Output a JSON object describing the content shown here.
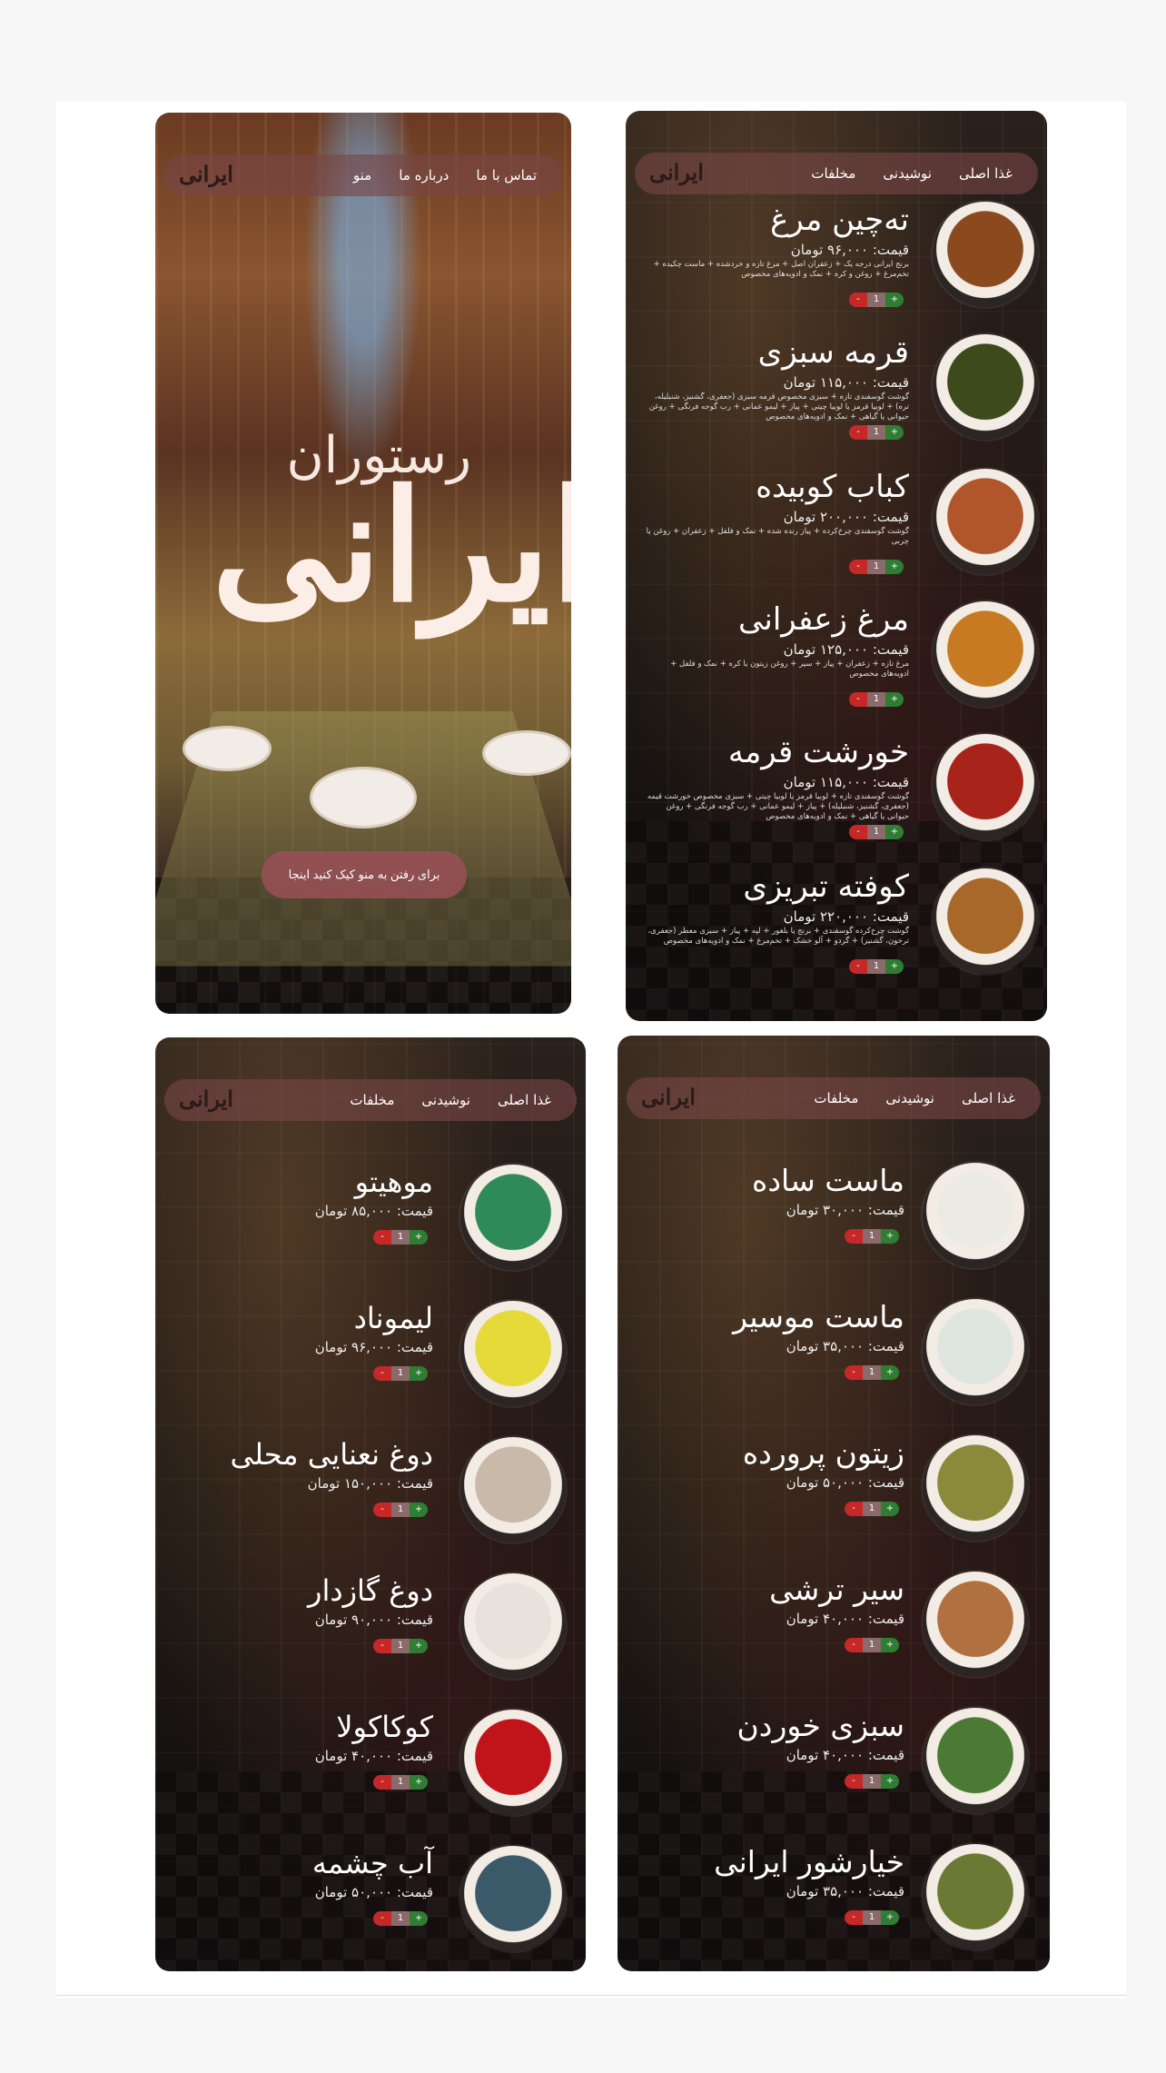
{
  "hero": {
    "logo": "ایرانی",
    "nav": [
      "تماس با ما",
      "درباره ما",
      "منو"
    ],
    "title_small": "رستوران",
    "title_big": "ایرانی",
    "cta": "برای رفتن به منو کیک کنید اینجا"
  },
  "menu_nav": [
    "غذا اصلی",
    "نوشیدنی",
    "مخلفات"
  ],
  "stepper": {
    "minus": "-",
    "qty": "1",
    "plus": "+"
  },
  "main_dishes": [
    {
      "name": "ته‌چین مرغ",
      "price": "قیمت: ۹۶,۰۰۰ تومان",
      "desc": "برنج ایرانی درجه یک + زعفران اصل + مرغ تازه و خردشده + ماست چکیده + تخم‌مرغ + روغن و کره + نمک و ادویه‌های مخصوص",
      "color": "#8a4a1e"
    },
    {
      "name": "قرمه سبزی",
      "price": "قیمت: ۱۱۵,۰۰۰ تومان",
      "desc": "گوشت گوسفندی تازه + سبزی مخصوص قرمه سبزی (جعفری، گشنیز، شنبلیله، تره) + لوبیا قرمز یا لوبیا چیتی + پیاز + لیمو عمانی + رب گوجه فرنگی + روغن حیوانی یا گیاهی + نمک و ادویه‌های مخصوص",
      "color": "#3d4a1c"
    },
    {
      "name": "کباب کوبیده",
      "price": "قیمت: ۲۰۰,۰۰۰ تومان",
      "desc": "گوشت گوسفندی چرخ‌کرده + پیاز رنده شده + نمک و فلفل + زعفران + روغن یا چربی",
      "color": "#b0562a"
    },
    {
      "name": "مرغ زعفرانی",
      "price": "قیمت: ۱۲۵,۰۰۰ تومان",
      "desc": "مرغ تازه + زعفران + پیاز + سیر + روغن زیتون یا کره + نمک و فلفل + ادویه‌های مخصوص",
      "color": "#c77a22"
    },
    {
      "name": "خورشت قرمه",
      "price": "قیمت: ۱۱۵,۰۰۰ تومان",
      "desc": "گوشت گوسفندی تازه + لوبیا قرمز یا لوبیا چیتی + سبزی مخصوص خورشت قیمه (جعفری، گشنیز، شنبلیله) + پیاز + لیمو عمانی + رب گوجه فرنگی + روغن حیوانی یا گیاهی + نمک و ادویه‌های مخصوص",
      "color": "#a8241a"
    },
    {
      "name": "کوفته تبریزی",
      "price": "قیمت: ۲۲۰,۰۰۰ تومان",
      "desc": "گوشت چرخ‌کرده گوسفندی + برنج یا بلغور + لپه + پیاز + سبزی معطر (جعفری، ترخون، گشنیز) + گردو + آلو خشک + تخم‌مرغ + نمک و ادویه‌های مخصوص",
      "color": "#a8682a"
    }
  ],
  "drinks": [
    {
      "name": "موهیتو",
      "price": "قیمت: ۸۵,۰۰۰ تومان",
      "color": "#2f8a5a"
    },
    {
      "name": "لیموناد",
      "price": "قیمت: ۹۶,۰۰۰ تومان",
      "color": "#e6d93a"
    },
    {
      "name": "دوغ نعنایی محلی",
      "price": "قیمت: ۱۵۰,۰۰۰ تومان",
      "color": "#c9b9a8"
    },
    {
      "name": "دوغ گازدار",
      "price": "قیمت: ۹۰,۰۰۰ تومان",
      "color": "#e9e2dc"
    },
    {
      "name": "کوکاکولا",
      "price": "قیمت: ۴۰,۰۰۰ تومان",
      "color": "#c0141a"
    },
    {
      "name": "آب چشمه",
      "price": "قیمت: ۵۰,۰۰۰ تومان",
      "color": "#3a5a6a"
    }
  ],
  "sides": [
    {
      "name": "ماست ساده",
      "price": "قیمت: ۳۰,۰۰۰ تومان",
      "color": "#eceae4"
    },
    {
      "name": "ماست موسیر",
      "price": "قیمت: ۳۵,۰۰۰ تومان",
      "color": "#dfe6e0"
    },
    {
      "name": "زیتون پرورده",
      "price": "قیمت: ۵۰,۰۰۰ تومان",
      "color": "#8a8a3a"
    },
    {
      "name": "سیر ترشی",
      "price": "قیمت: ۴۰,۰۰۰ تومان",
      "color": "#b07040"
    },
    {
      "name": "سبزی خوردن",
      "price": "قیمت: ۴۰,۰۰۰ تومان",
      "color": "#4a7a34"
    },
    {
      "name": "خیارشور ایرانی",
      "price": "قیمت: ۳۵,۰۰۰ تومان",
      "color": "#6a7a34"
    }
  ]
}
